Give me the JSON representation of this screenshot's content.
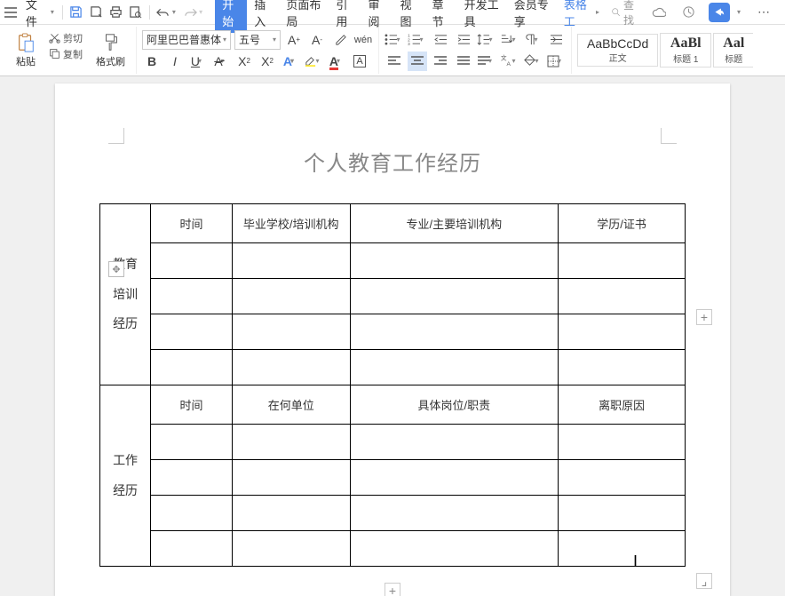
{
  "menubar": {
    "file": "文件",
    "tabs": [
      "开始",
      "插入",
      "页面布局",
      "引用",
      "审阅",
      "视图",
      "章节",
      "开发工具",
      "会员专享",
      "表格工"
    ],
    "active_index": 0,
    "context_index": 9,
    "search_placeholder": "查找"
  },
  "ribbon": {
    "clipboard": {
      "paste": "粘贴",
      "cut": "剪切",
      "copy": "复制",
      "format_painter": "格式刷"
    },
    "font": {
      "name": "阿里巴巴普惠体",
      "size": "五号"
    },
    "styles": {
      "normal_preview": "AaBbCcDd",
      "normal_label": "正文",
      "h1_preview": "AaBl",
      "h1_label": "标题 1",
      "h2_preview": "Aal",
      "h2_label": "标题"
    }
  },
  "document": {
    "title": "个人教育工作经历",
    "section1": {
      "vhead": "教育\n培训\n经历",
      "headers": [
        "时间",
        "毕业学校/培训机构",
        "专业/主要培训机构",
        "学历/证书"
      ]
    },
    "section2": {
      "vhead": "工作\n经历",
      "headers": [
        "时间",
        "在何单位",
        "具体岗位/职责",
        "离职原因"
      ]
    }
  }
}
